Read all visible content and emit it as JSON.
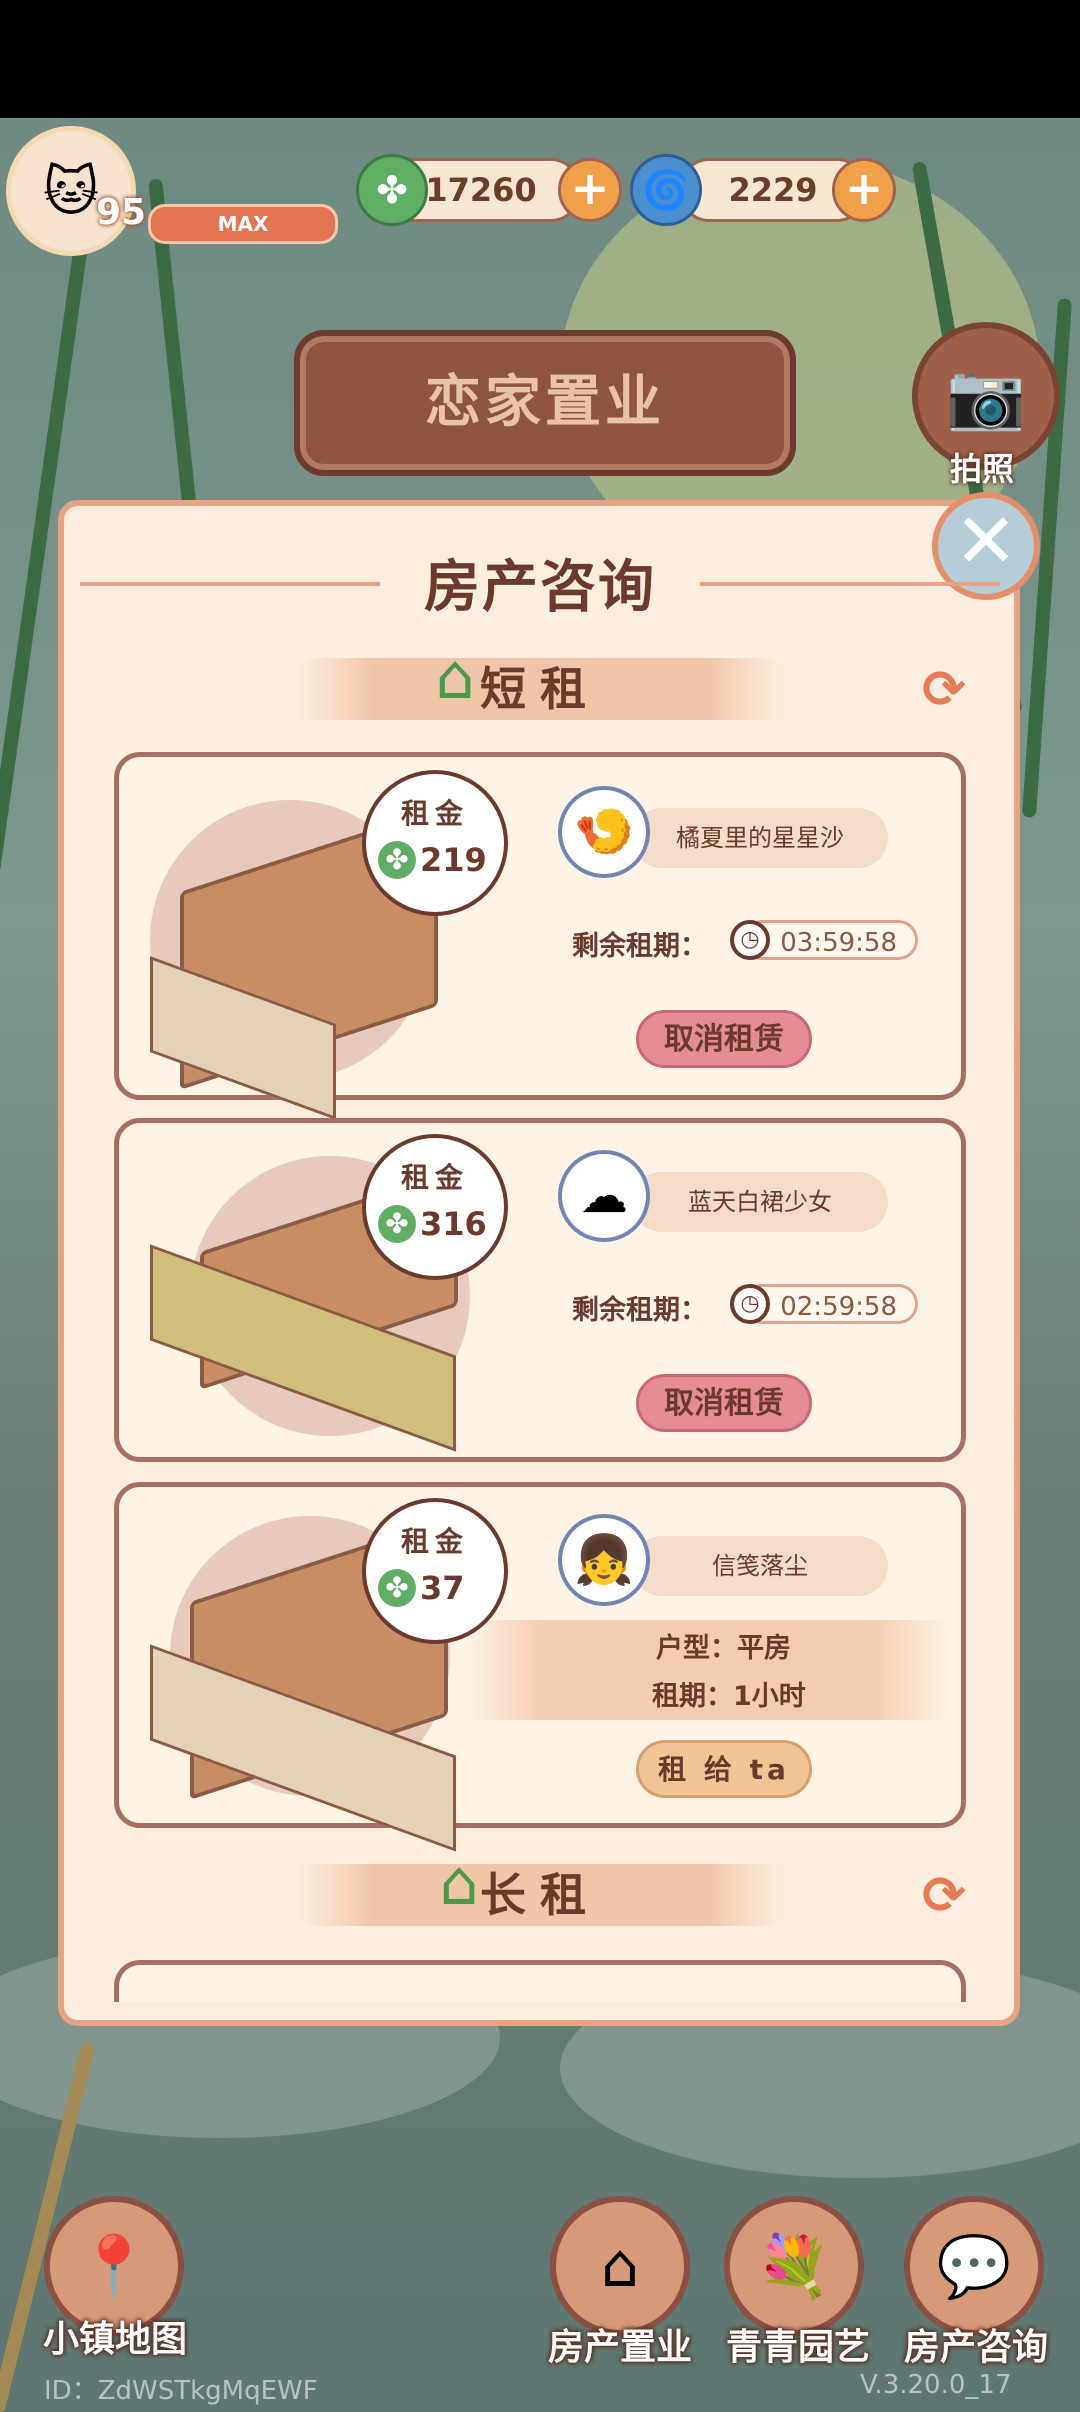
{
  "hud": {
    "level": "95",
    "max_label": "MAX",
    "clover_currency": "17260",
    "gem_currency": "2229"
  },
  "sign": {
    "title": "恋家置业"
  },
  "camera": {
    "label": "拍照"
  },
  "panel": {
    "title": "房产咨询",
    "short_section": "短租",
    "long_section": "长租",
    "rent_label": "租金",
    "remaining_label": "剩余租期："
  },
  "cards": [
    {
      "rent": "219",
      "tenant": "橘夏里的星星沙",
      "remaining": "03:59:58",
      "action": "取消租赁"
    },
    {
      "rent": "316",
      "tenant": "蓝天白裙少女",
      "remaining": "02:59:58",
      "action": "取消租赁"
    },
    {
      "rent": "37",
      "tenant": "信笺落尘",
      "type": "户型：平房",
      "period": "租期：1小时",
      "action": "租 给 ta"
    }
  ],
  "bottom": {
    "map": "小镇地图",
    "property": "房产置业",
    "garden": "青青园艺",
    "consult": "房产咨询"
  },
  "footer": {
    "id": "ID：ZdWSTkgMqEWF",
    "version": "V.3.20.0_17"
  }
}
